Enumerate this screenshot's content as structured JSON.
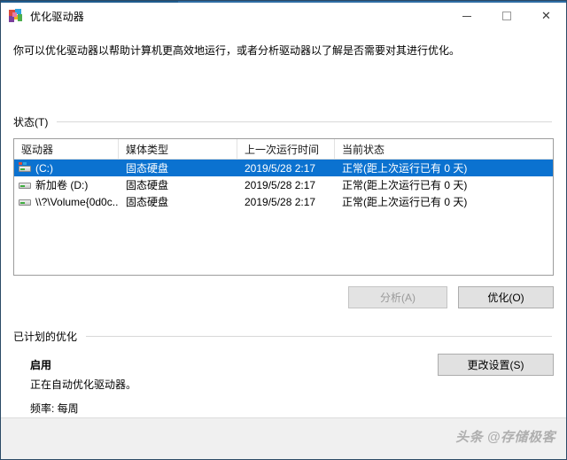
{
  "window": {
    "title": "优化驱动器",
    "icon": "defrag-icon",
    "accent_color": "#1f5c8f",
    "controls": {
      "minimize": "minimize-icon",
      "maximize": "maximize-icon",
      "close": "close-icon"
    }
  },
  "intro": {
    "text": "你可以优化驱动器以帮助计算机更高效地运行，或者分析驱动器以了解是否需要对其进行优化。"
  },
  "status_section": {
    "group_label": "状态(T)",
    "columns": [
      {
        "key": "drive",
        "label": "驱动器"
      },
      {
        "key": "media",
        "label": "媒体类型"
      },
      {
        "key": "last_run",
        "label": "上一次运行时间"
      },
      {
        "key": "current_status",
        "label": "当前状态"
      }
    ],
    "rows": [
      {
        "icon": "system-drive-icon",
        "drive": "(C:)",
        "media": "固态硬盘",
        "last_run": "2019/5/28 2:17",
        "current_status": "正常(距上次运行已有 0 天)",
        "selected": true
      },
      {
        "icon": "drive-icon",
        "drive": "新加卷 (D:)",
        "media": "固态硬盘",
        "last_run": "2019/5/28 2:17",
        "current_status": "正常(距上次运行已有 0 天)",
        "selected": false
      },
      {
        "icon": "drive-icon",
        "drive": "\\\\?\\Volume{0d0c...",
        "media": "固态硬盘",
        "last_run": "2019/5/28 2:17",
        "current_status": "正常(距上次运行已有 0 天)",
        "selected": false
      }
    ],
    "buttons": {
      "analyze": {
        "label": "分析(A)",
        "enabled": false
      },
      "optimize": {
        "label": "优化(O)",
        "enabled": true
      }
    }
  },
  "scheduled_section": {
    "group_label": "已计划的优化",
    "enabled_label": "启用",
    "description": "正在自动优化驱动器。",
    "frequency": "频率: 每周",
    "change_settings_button": "更改设置(S)"
  },
  "footer": {
    "watermark": "头条 @存储极客"
  }
}
